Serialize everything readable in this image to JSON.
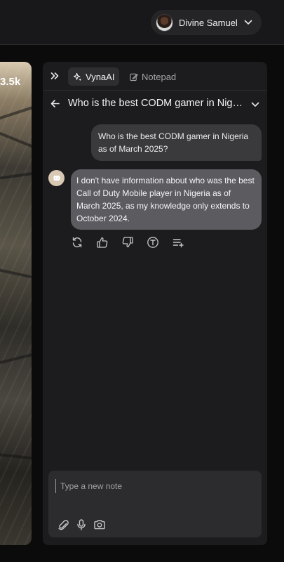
{
  "header": {
    "user_name": "Divine Samuel"
  },
  "image_panel": {
    "count_label": "3.5k"
  },
  "panel": {
    "tabs": [
      {
        "label": "VynaAI",
        "icon": "sparkle-icon",
        "active": true
      },
      {
        "label": "Notepad",
        "icon": "notepad-icon",
        "active": false
      }
    ],
    "chat_title": "Who is the best CODM gamer in Nigeria as of March 2025?",
    "messages": [
      {
        "role": "user",
        "text": "Who is the best CODM gamer in Nigeria as of March 2025?"
      },
      {
        "role": "assistant",
        "text": "I don't have information about who was the best Call of Duty Mobile player in Nigeria as of March 2025, as my knowledge only extends to October 2024."
      }
    ],
    "message_actions": [
      "regenerate-icon",
      "thumbs-up-icon",
      "thumbs-down-icon",
      "text-icon",
      "add-to-list-icon"
    ],
    "note": {
      "placeholder": "Type a new note",
      "value": "",
      "tools": [
        "attach-icon",
        "microphone-icon",
        "camera-icon"
      ]
    }
  },
  "colors": {
    "background": "#0b0b0c",
    "panel": "#1c1c1e",
    "user_bubble": "#3a3a3d",
    "assistant_bubble": "#5c5c60",
    "bot_avatar": "#d9c8b4"
  }
}
